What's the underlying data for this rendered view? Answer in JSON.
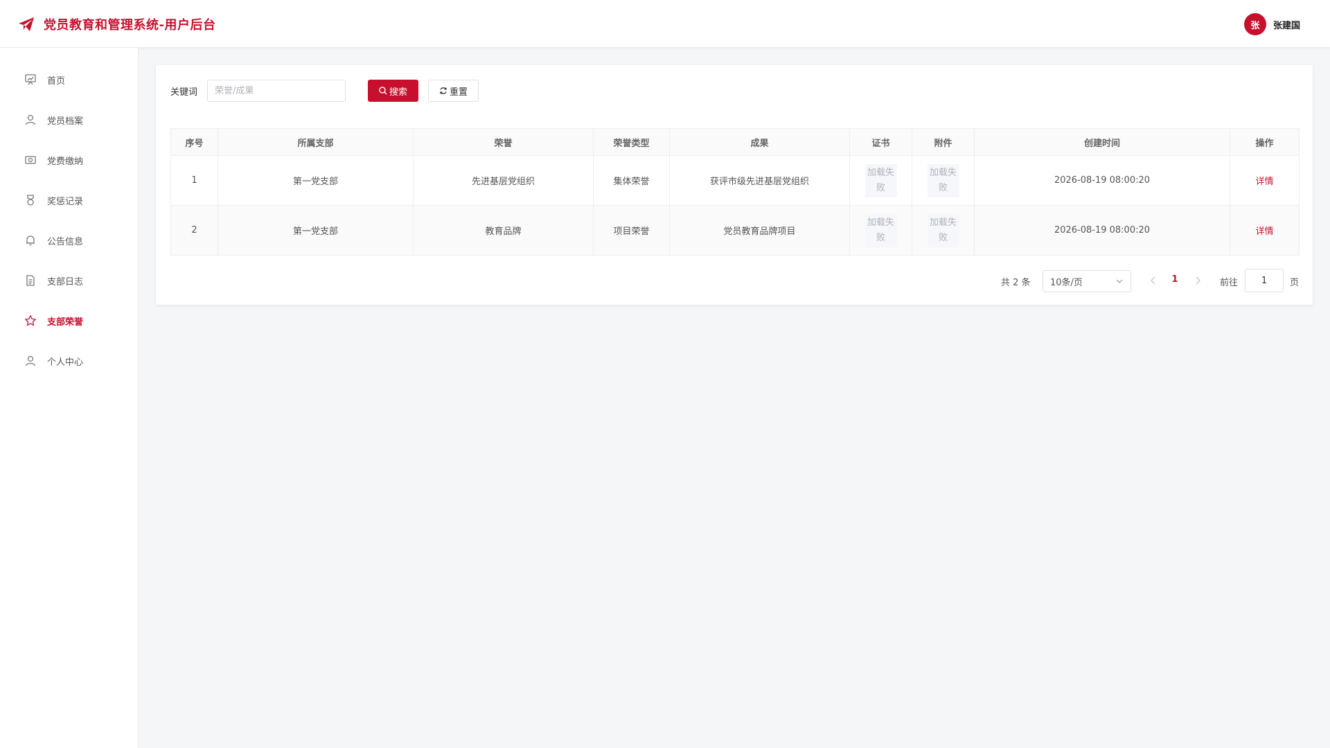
{
  "header": {
    "title": "党员教育和管理系统-用户后台",
    "avatar_text": "张",
    "username": "张建国",
    "brand_color": "#c8102e"
  },
  "sidebar": {
    "items": [
      {
        "label": "首页",
        "icon": "home-icon"
      },
      {
        "label": "党员档案",
        "icon": "user-icon"
      },
      {
        "label": "党费缴纳",
        "icon": "money-icon"
      },
      {
        "label": "奖惩记录",
        "icon": "medal-icon"
      },
      {
        "label": "公告信息",
        "icon": "bell-icon"
      },
      {
        "label": "支部日志",
        "icon": "document-icon"
      },
      {
        "label": "支部荣誉",
        "icon": "star-icon",
        "active": true
      },
      {
        "label": "个人中心",
        "icon": "user-icon"
      }
    ]
  },
  "search": {
    "label": "关键词",
    "value": "",
    "placeholder": "荣誉/成果",
    "search_button": "搜索",
    "reset_button": "重置"
  },
  "table": {
    "columns": [
      "序号",
      "所属支部",
      "荣誉",
      "荣誉类型",
      "成果",
      "证书",
      "附件",
      "创建时间",
      "操作"
    ],
    "rows": [
      {
        "index": "1",
        "branch": "第一党支部",
        "honor": "先进基层党组织",
        "type": "集体荣誉",
        "achievement": "获评市级先进基层党组织",
        "certificate": "加载失败",
        "attachment": "加载失败",
        "created": "2026-08-19 08:00:20",
        "action": "详情"
      },
      {
        "index": "2",
        "branch": "第一党支部",
        "honor": "教育品牌",
        "type": "项目荣誉",
        "achievement": "党员教育品牌项目",
        "certificate": "加载失败",
        "attachment": "加载失败",
        "created": "2026-08-19 08:00:20",
        "action": "详情"
      }
    ]
  },
  "pagination": {
    "total": "共 2 条",
    "page_size": "10条/页",
    "current_page": "1",
    "goto_label": "前往",
    "goto_value": "1",
    "page_suffix": "页"
  }
}
